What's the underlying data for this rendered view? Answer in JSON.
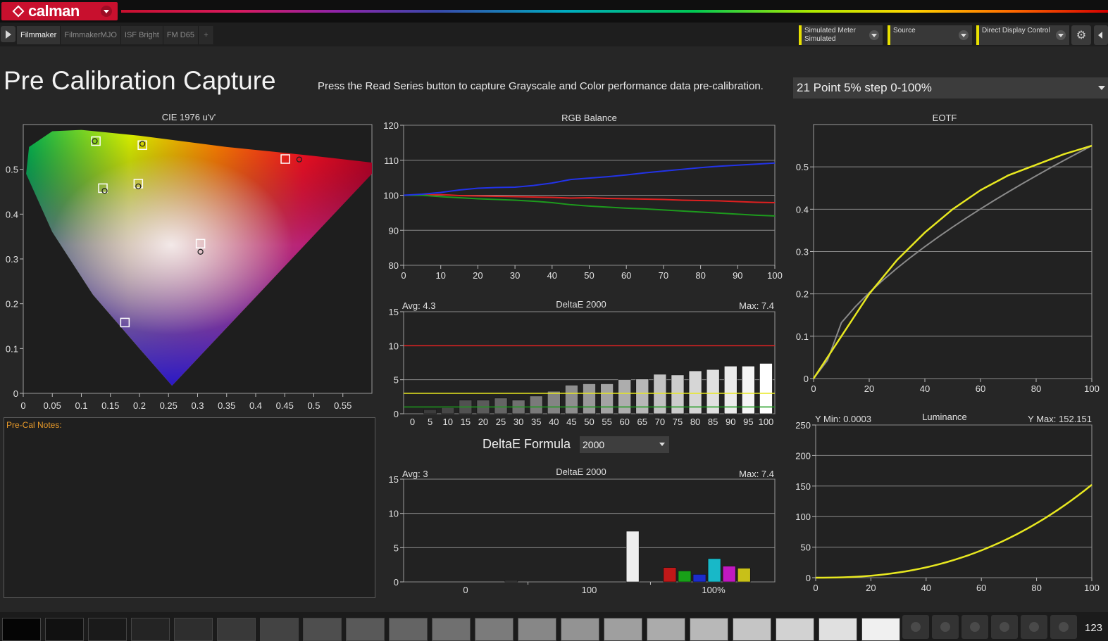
{
  "app": {
    "brand": "calman"
  },
  "tabs": [
    {
      "label": "Filmmaker",
      "active": true
    },
    {
      "label": "FilmmakerMJO",
      "active": false
    },
    {
      "label": "ISF Bright",
      "active": false
    },
    {
      "label": "FM D65",
      "active": false
    },
    {
      "label": "+",
      "active": false
    }
  ],
  "devices": {
    "meter": {
      "line1": "Simulated Meter",
      "line2": "Simulated"
    },
    "source": {
      "line1": "Source",
      "line2": ""
    },
    "display": {
      "line1": "Direct Display Control",
      "line2": ""
    }
  },
  "header": {
    "title": "Pre Calibration Capture",
    "instruction": "Press the Read Series button to capture Grayscale and Color performance data pre-calibration.",
    "series_selected": "21 Point 5% step 0-100%"
  },
  "notes": {
    "label": "Pre-Cal Notes:"
  },
  "formula": {
    "label": "DeltaE Formula",
    "value": "2000"
  },
  "counter": "123",
  "colors": {
    "accent": "#e8e000",
    "brand": "#c8102e",
    "red": "#e02020",
    "green": "#20a020",
    "blue": "#2030e0",
    "yellow": "#e8e820"
  },
  "chart_data": [
    {
      "id": "cie",
      "type": "scatter",
      "title": "CIE 1976 u'v'",
      "xlim": [
        0,
        0.6
      ],
      "ylim": [
        0,
        0.6
      ],
      "xticks": [
        "0",
        "0.05",
        "0.1",
        "0.15",
        "0.2",
        "0.25",
        "0.3",
        "0.35",
        "0.4",
        "0.45",
        "0.5",
        "0.55"
      ],
      "yticks": [
        "0",
        "0.1",
        "0.2",
        "0.3",
        "0.4",
        "0.5"
      ],
      "targets": [
        [
          0.451,
          0.523
        ],
        [
          0.125,
          0.563
        ],
        [
          0.175,
          0.158
        ],
        [
          0.198,
          0.468
        ],
        [
          0.205,
          0.554
        ],
        [
          0.137,
          0.458
        ],
        [
          0.305,
          0.334
        ]
      ],
      "measured": [
        [
          0.475,
          0.522
        ],
        [
          0.123,
          0.563
        ],
        [
          0.205,
          0.557
        ],
        [
          0.14,
          0.452
        ],
        [
          0.198,
          0.462
        ],
        [
          0.305,
          0.316
        ]
      ]
    },
    {
      "id": "rgb",
      "type": "line",
      "title": "RGB Balance",
      "xlim": [
        0,
        100
      ],
      "ylim": [
        80,
        120
      ],
      "xticks": [
        "0",
        "10",
        "20",
        "30",
        "40",
        "50",
        "60",
        "70",
        "80",
        "90",
        "100"
      ],
      "yticks": [
        "80",
        "90",
        "100",
        "110",
        "120"
      ],
      "x": [
        0,
        5,
        10,
        15,
        20,
        25,
        30,
        35,
        40,
        45,
        50,
        55,
        60,
        65,
        70,
        75,
        80,
        85,
        90,
        95,
        100
      ],
      "series": [
        {
          "color": "red",
          "values": [
            100,
            100,
            100.2,
            99.9,
            99.8,
            99.7,
            99.6,
            99.5,
            99.4,
            99.2,
            99.3,
            99.1,
            99.0,
            98.9,
            98.8,
            98.6,
            98.5,
            98.4,
            98.2,
            98.0,
            97.9
          ]
        },
        {
          "color": "green",
          "values": [
            100,
            100,
            99.6,
            99.3,
            99.0,
            98.8,
            98.6,
            98.3,
            97.9,
            97.3,
            96.9,
            96.6,
            96.3,
            96.1,
            95.8,
            95.5,
            95.2,
            94.9,
            94.6,
            94.3,
            94.1
          ]
        },
        {
          "color": "blue",
          "values": [
            100,
            100.3,
            100.8,
            101.5,
            102.0,
            102.2,
            102.3,
            102.8,
            103.5,
            104.5,
            104.9,
            105.3,
            105.8,
            106.4,
            106.9,
            107.4,
            107.9,
            108.3,
            108.6,
            108.9,
            109.2
          ]
        }
      ]
    },
    {
      "id": "grayscale",
      "type": "bar",
      "title": "DeltaE 2000",
      "avg_label": "Avg: 4.3",
      "max_label": "Max: 7.4",
      "ylim": [
        0,
        15
      ],
      "yticks": [
        "0",
        "5",
        "10",
        "15"
      ],
      "categories": [
        "0",
        "5",
        "10",
        "15",
        "20",
        "25",
        "30",
        "35",
        "40",
        "45",
        "50",
        "55",
        "60",
        "65",
        "70",
        "75",
        "80",
        "85",
        "90",
        "95",
        "100"
      ],
      "values": [
        0,
        0.6,
        0.9,
        2.0,
        2.0,
        2.3,
        2.0,
        2.6,
        3.3,
        4.2,
        4.4,
        4.4,
        5.0,
        5.1,
        5.8,
        5.7,
        6.3,
        6.5,
        7.0,
        7.0,
        7.4
      ],
      "thresholds": [
        {
          "value": 10,
          "color": "red"
        },
        {
          "value": 3,
          "color": "yellow"
        },
        {
          "value": 1,
          "color": "green"
        }
      ]
    },
    {
      "id": "colors",
      "type": "bar",
      "title": "DeltaE 2000",
      "avg_label": "Avg: 3",
      "max_label": "Max: 7.4",
      "ylim": [
        0,
        15
      ],
      "yticks": [
        "0",
        "5",
        "10",
        "15"
      ],
      "xticks": [
        "0",
        "100",
        "100%"
      ],
      "bars": [
        {
          "pos": 0.29,
          "value": 0.2,
          "color": "#444"
        },
        {
          "pos": 0.617,
          "value": 7.4,
          "color": "white"
        },
        {
          "pos": 0.717,
          "value": 2.1,
          "color": "#c01818"
        },
        {
          "pos": 0.757,
          "value": 1.6,
          "color": "#18a018"
        },
        {
          "pos": 0.797,
          "value": 1.1,
          "color": "#1c2ccc"
        },
        {
          "pos": 0.837,
          "value": 3.4,
          "color": "#18b8c8"
        },
        {
          "pos": 0.877,
          "value": 2.3,
          "color": "#c018c0"
        },
        {
          "pos": 0.917,
          "value": 2.0,
          "color": "#c8c018"
        }
      ]
    },
    {
      "id": "eotf",
      "type": "line",
      "title": "EOTF",
      "xlim": [
        0,
        100
      ],
      "ylim": [
        0,
        0.6
      ],
      "xticks": [
        "0",
        "20",
        "40",
        "60",
        "80",
        "100"
      ],
      "yticks": [
        "0",
        "0.1",
        "0.2",
        "0.3",
        "0.4",
        "0.5"
      ],
      "series": [
        {
          "color": "gray",
          "gamma_ref": true
        },
        {
          "color": "yellow",
          "x": [
            0,
            5,
            10,
            15,
            20,
            30,
            40,
            50,
            60,
            70,
            80,
            90,
            100
          ],
          "values": [
            0,
            0.05,
            0.1,
            0.15,
            0.2,
            0.28,
            0.345,
            0.4,
            0.445,
            0.48,
            0.505,
            0.53,
            0.55
          ]
        }
      ]
    },
    {
      "id": "luminance",
      "type": "line",
      "title": "Luminance",
      "ymin_label": "Y Min: 0.0003",
      "ymax_label": "Y Max: 152.151",
      "xlim": [
        0,
        100
      ],
      "ylim": [
        0,
        250
      ],
      "xticks": [
        "0",
        "20",
        "40",
        "60",
        "80",
        "100"
      ],
      "yticks": [
        "0",
        "50",
        "100",
        "150",
        "200",
        "250"
      ],
      "series": [
        {
          "color": "yellow",
          "gamma": 2.4,
          "max": 152.151
        }
      ]
    }
  ],
  "swatches": [
    "#050505",
    "#111",
    "#1a1a1a",
    "#242424",
    "#2e2e2e",
    "#393939",
    "#434343",
    "#4e4e4e",
    "#595959",
    "#646464",
    "#707070",
    "#7b7b7b",
    "#878787",
    "#939393",
    "#9f9f9f",
    "#ababab",
    "#b8b8b8",
    "#c5c5c5",
    "#d2d2d2",
    "#e0e0e0",
    "#f0f0f0"
  ]
}
